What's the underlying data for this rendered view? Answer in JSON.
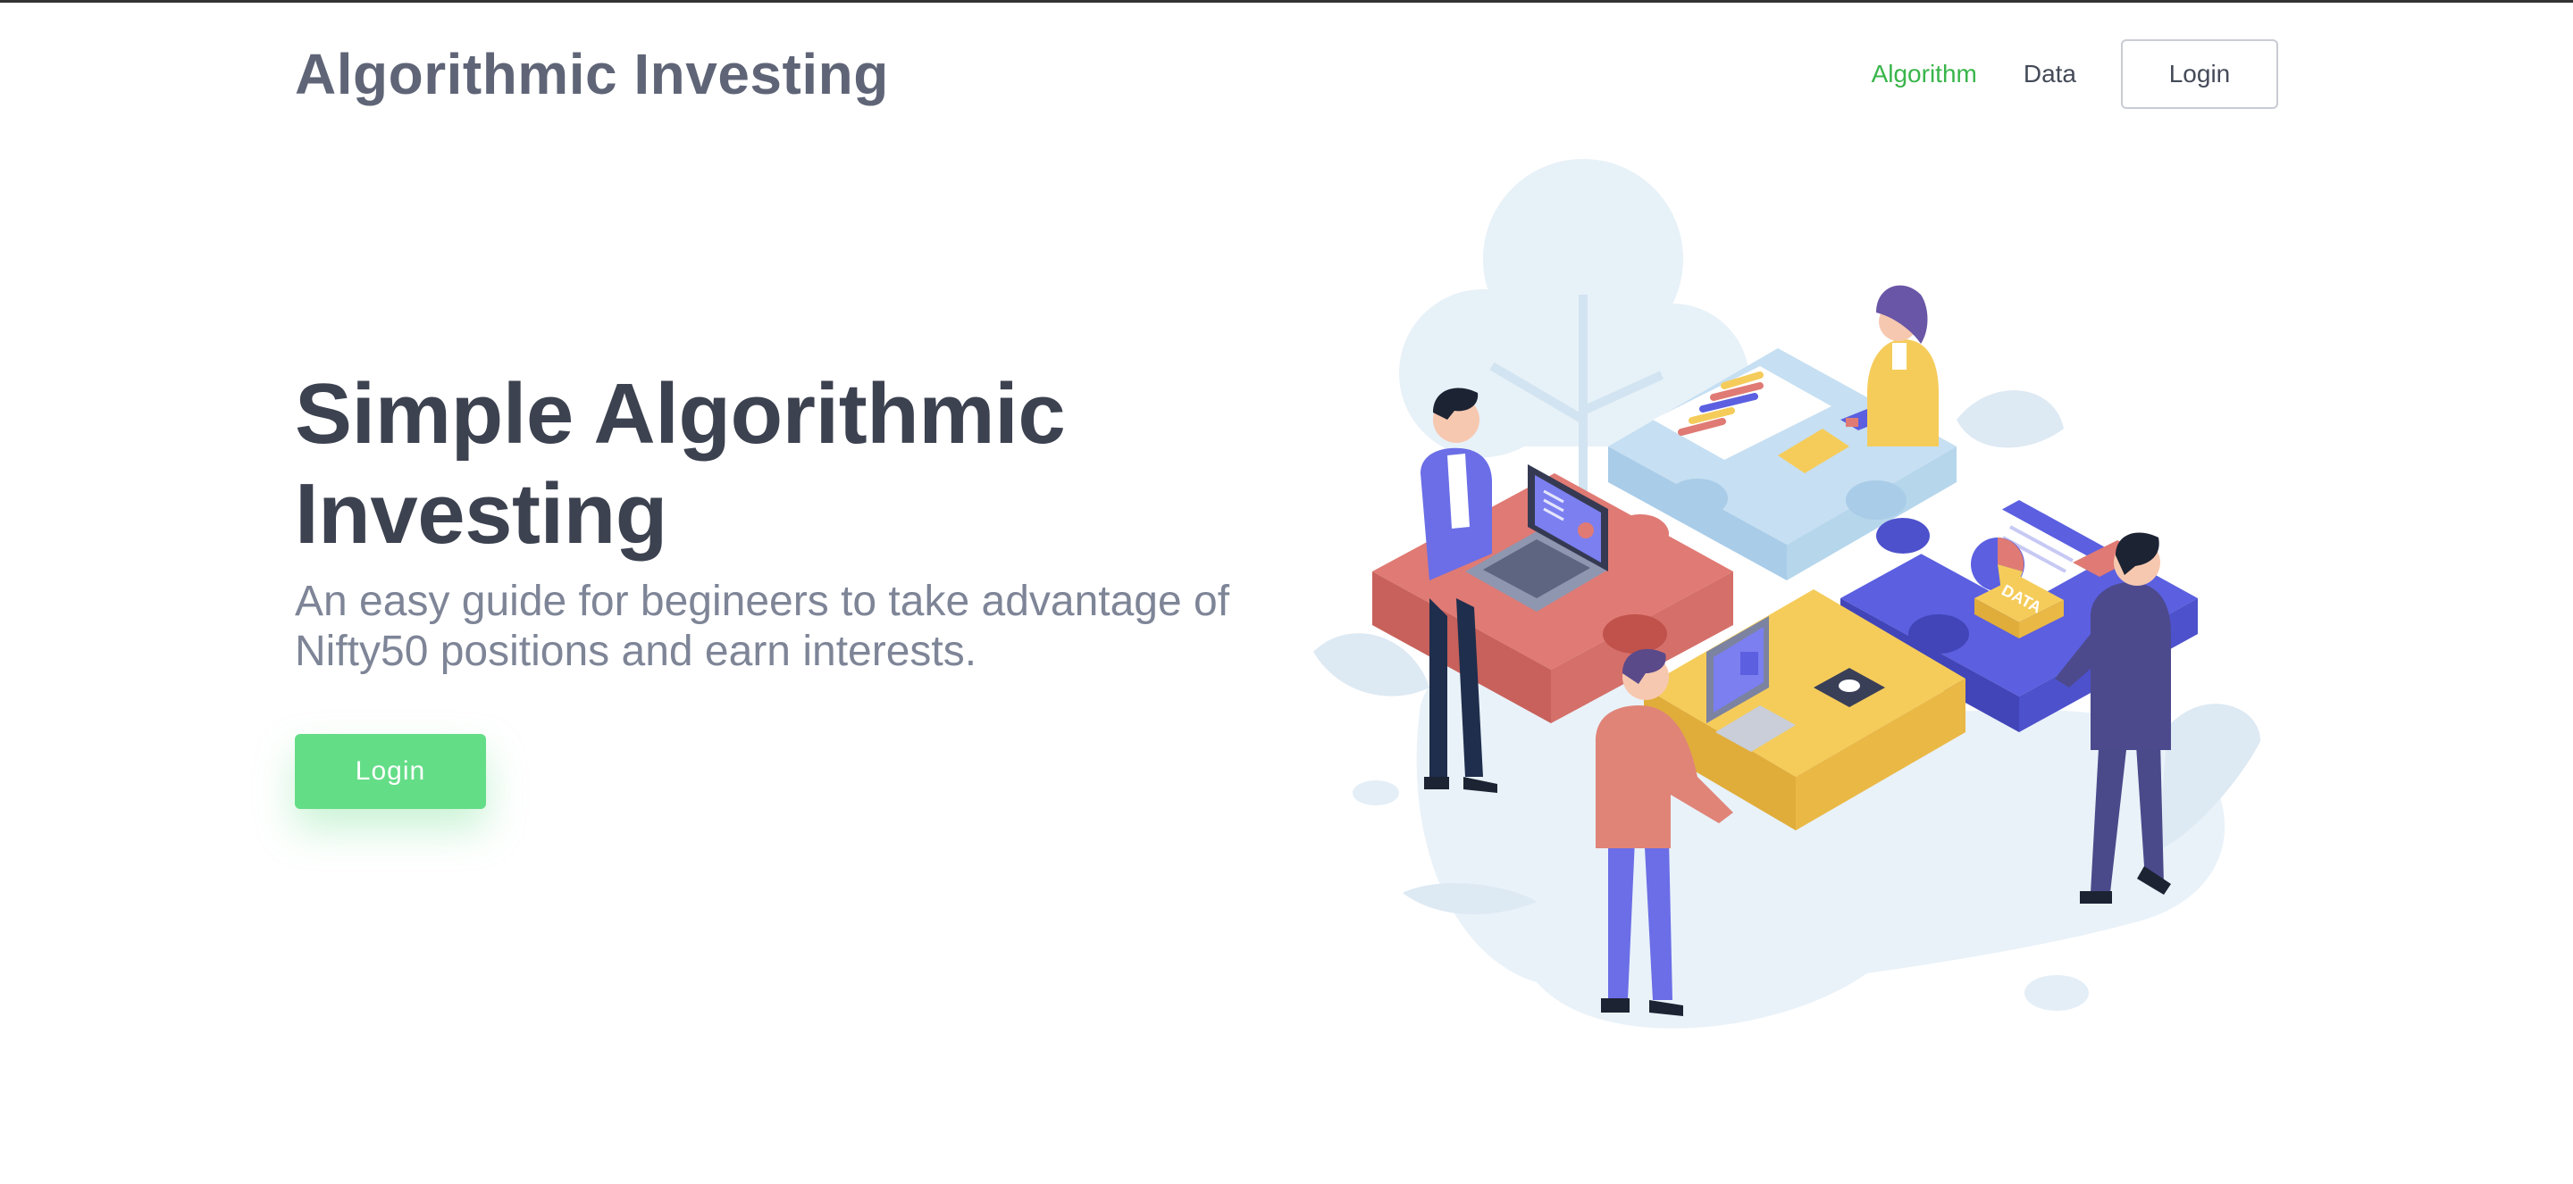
{
  "header": {
    "brand": "Algorithmic Investing",
    "nav": {
      "algorithm": "Algorithm",
      "data": "Data",
      "login": "Login"
    }
  },
  "hero": {
    "title": "Simple Algorithmic Investing",
    "subtitle": "An easy guide for begineers to take advantage of Nifty50 positions and earn interests.",
    "cta_label": "Login"
  },
  "illustration": {
    "tag_label": "DATA"
  },
  "colors": {
    "accent": "#39b54a",
    "cta": "#64dd87",
    "heading": "#3d4250",
    "subtext": "#7e8597",
    "puzzle_red": "#e07a74",
    "puzzle_yellow": "#f5cc5a",
    "puzzle_blue": "#5b5fe0",
    "puzzle_light": "#c6dff2"
  },
  "icons": {
    "illustration": "team-puzzle-illustration"
  }
}
